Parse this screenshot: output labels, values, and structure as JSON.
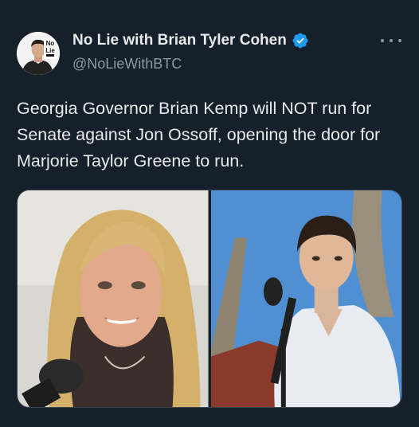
{
  "author": {
    "display_name": "No Lie with Brian Tyler Cohen",
    "handle": "@NoLieWithBTC",
    "verified": true,
    "avatar_icon": "no-lie-avatar-icon",
    "avatar_logo_text": [
      "No",
      "Lie"
    ]
  },
  "tweet": {
    "text": "Georgia Governor Brian Kemp will NOT run for Senate against Jon Ossoff, opening the door for Marjorie Taylor Greene to run."
  },
  "media": {
    "photos": [
      {
        "icon": "woman-speaking-photo"
      },
      {
        "icon": "man-at-microphone-photo"
      }
    ]
  },
  "colors": {
    "background": "#15202b",
    "text": "#e7e9ea",
    "secondary": "#8b98a5",
    "verified_blue": "#1d9bf0"
  },
  "icons": {
    "more": "more-options-icon",
    "verified": "verified-badge-icon"
  }
}
